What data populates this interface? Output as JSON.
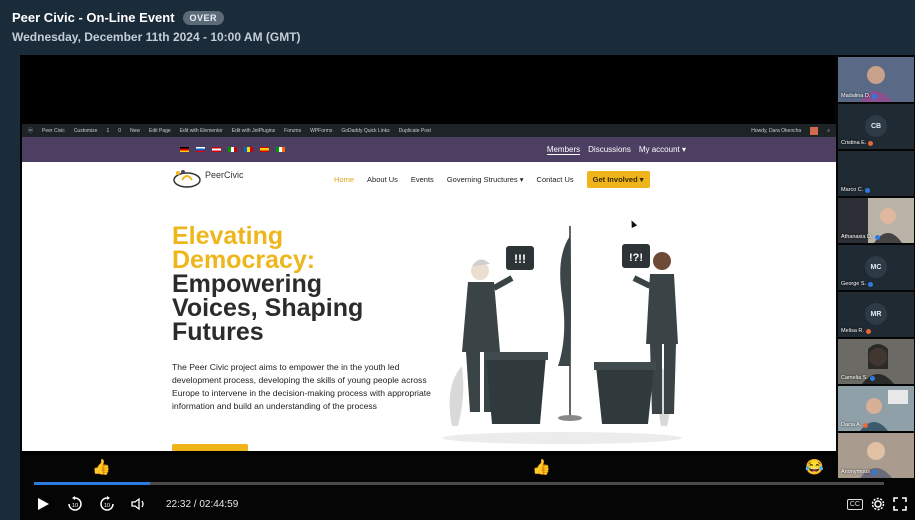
{
  "event": {
    "title": "Peer Civic - On-Line Event",
    "status_badge": "OVER",
    "datetime": "Wednesday, December 11th 2024 - 10:00 AM (GMT)"
  },
  "wp_admin_bar": {
    "items": [
      "Peer Civic",
      "Customize",
      "1",
      "0",
      "New",
      "Edit Page",
      "Edit with Elementor",
      "Edit with JetPlugins",
      "Forums",
      "WPForms",
      "GoDaddy Quick Links",
      "Duplicate Post"
    ],
    "howdy": "Howdy, Dara Okeocha"
  },
  "site": {
    "top_links": [
      "Members",
      "Discussions",
      "My account ▾"
    ],
    "logo_text": "PeerCivic",
    "menu": {
      "home": "Home",
      "about": "About Us",
      "events": "Events",
      "governing": "Governing Structures ▾",
      "contact": "Contact Us",
      "cta": "Get Involved ▾"
    },
    "hero_gold_1": "Elevating",
    "hero_gold_2": "Democracy:",
    "hero_dark_1": "Empowering",
    "hero_dark_2": "Voices, Shaping",
    "hero_dark_3": "Futures",
    "hero_paragraph": "The Peer Civic project aims to empower the in the youth led development process, developing the skills of young people across Europe to intervene in the decision-making process with appropriate information and build an understanding of the process",
    "speech_left": "!!!",
    "speech_right": "!?!"
  },
  "participants": [
    {
      "name": "Madalina D.",
      "type": "video",
      "bg": "#5a6a86"
    },
    {
      "name": "Cristina E.",
      "type": "initials",
      "initials": "CB"
    },
    {
      "name": "Marco C.",
      "type": "blank"
    },
    {
      "name": "Athanasia D.",
      "type": "video",
      "bg": "#b9b3a8"
    },
    {
      "name": "George S.",
      "type": "initials",
      "initials": "MC"
    },
    {
      "name": "Melisa R.",
      "type": "initials",
      "initials": "MR"
    },
    {
      "name": "Camelia S.",
      "type": "video",
      "bg": "#6b6a64"
    },
    {
      "name": "Dacia A.",
      "type": "video",
      "bg": "#8fa0a8"
    },
    {
      "name": "Anonymous",
      "type": "video",
      "bg": "#a99c8e"
    }
  ],
  "player": {
    "time": "22:32 / 02:44:59",
    "progress_fraction": 0.136,
    "skip_back": "10",
    "skip_forward": "10",
    "cc_label": "CC"
  },
  "colors": {
    "accent": "#2e7be0",
    "brand_gold": "#efb61c",
    "brand_purple": "#4c3f62"
  }
}
